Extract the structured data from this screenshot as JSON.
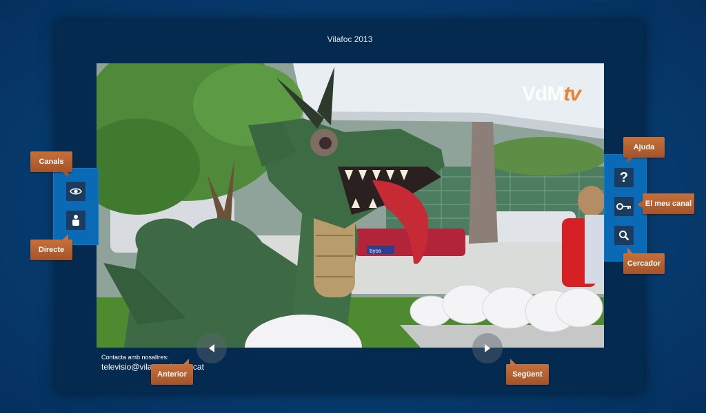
{
  "title": "Vilafoc 2013",
  "video": {
    "watermark_main": "VdM",
    "watermark_tv": "tv",
    "sign_text": "byos"
  },
  "left_menu": {
    "canals_label": "Canals",
    "directe_label": "Directe",
    "icons": [
      "eye-icon",
      "person-icon"
    ]
  },
  "right_menu": {
    "ajuda_label": "Ajuda",
    "meu_canal_label": "El meu canal",
    "cercador_label": "Cercador",
    "icons": [
      "question-icon",
      "key-icon",
      "search-icon"
    ]
  },
  "nav": {
    "anterior_label": "Anterior",
    "seguent_label": "Següent"
  },
  "contact": {
    "label": "Contacta amb nosaltres:",
    "email": "televisio@vilassardemar.cat"
  },
  "colors": {
    "accent": "#b75d2c",
    "side_panel": "#0a6ab5",
    "panel": "#052a50",
    "background": "#06386a"
  }
}
